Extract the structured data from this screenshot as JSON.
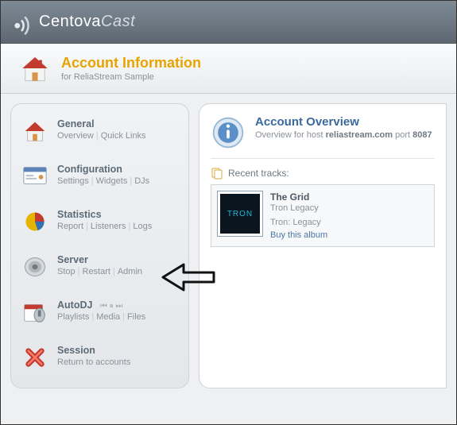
{
  "brand": {
    "part1": "Centova",
    "part2": "Cast"
  },
  "page": {
    "title": "Account Information",
    "subtitle_prefix": "for ",
    "subtitle_account": "ReliaStream Sample"
  },
  "sidebar": {
    "sections": [
      {
        "title": "General",
        "links": [
          "Overview",
          "Quick Links"
        ],
        "icon": "house"
      },
      {
        "title": "Configuration",
        "links": [
          "Settings",
          "Widgets",
          "DJs"
        ],
        "icon": "window"
      },
      {
        "title": "Statistics",
        "links": [
          "Report",
          "Listeners",
          "Logs"
        ],
        "icon": "pie"
      },
      {
        "title": "Server",
        "links": [
          "Stop",
          "Restart",
          "Admin"
        ],
        "icon": "speaker"
      },
      {
        "title": "AutoDJ",
        "extra": "⏮ ⏸ ⏭",
        "links": [
          "Playlists",
          "Media",
          "Files"
        ],
        "icon": "calendar-mic"
      },
      {
        "title": "Session",
        "links": [
          "Return to accounts"
        ],
        "icon": "x-red"
      }
    ]
  },
  "overview": {
    "title": "Account Overview",
    "subline_prefix": "Overview for host ",
    "host": "reliastream.com",
    "port_prefix": " port ",
    "port": "8087"
  },
  "recent": {
    "label": "Recent tracks:",
    "track": {
      "title": "The Grid",
      "artist": "Tron Legacy",
      "album": "Tron: Legacy",
      "buy": "Buy this album",
      "cover_text": "TRON"
    }
  }
}
